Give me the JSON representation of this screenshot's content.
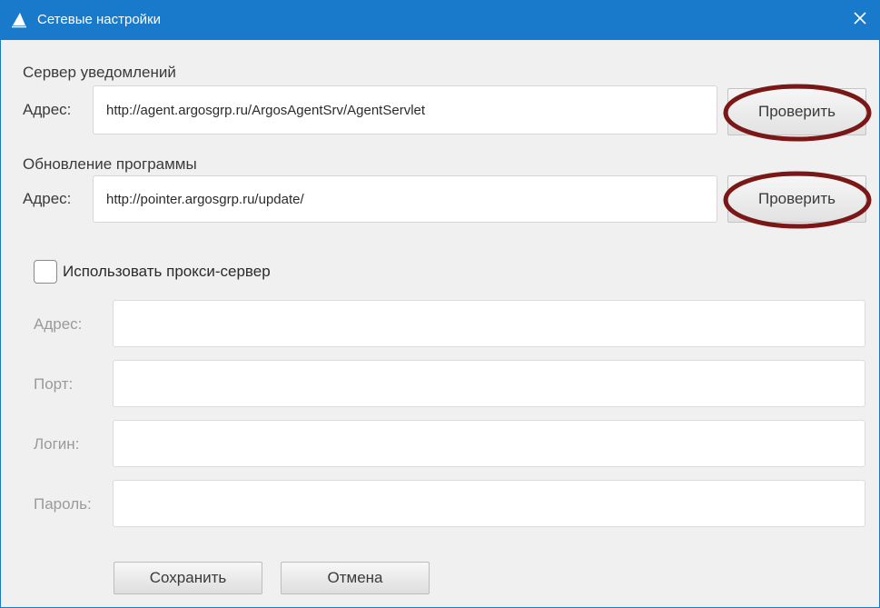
{
  "window": {
    "title": "Сетевые настройки",
    "accent_color": "#1979ca",
    "highlight_color": "#7a1717",
    "app_icon": "sail-icon",
    "close_icon": "close-icon"
  },
  "notification_server": {
    "section_title": "Сервер уведомлений",
    "address_label": "Адрес:",
    "address_value": "http://agent.argosgrp.ru/ArgosAgentSrv/AgentServlet",
    "check_button": "Проверить"
  },
  "program_update": {
    "section_title": "Обновление программы",
    "address_label": "Адрес:",
    "address_value": "http://pointer.argosgrp.ru/update/",
    "check_button": "Проверить"
  },
  "proxy": {
    "use_proxy_label": "Использовать прокси-сервер",
    "use_proxy_checked": false,
    "address_label": "Адрес:",
    "address_value": "",
    "port_label": "Порт:",
    "port_value": "",
    "login_label": "Логин:",
    "login_value": "",
    "password_label": "Пароль:",
    "password_value": ""
  },
  "actions": {
    "save_label": "Сохранить",
    "cancel_label": "Отмена"
  }
}
